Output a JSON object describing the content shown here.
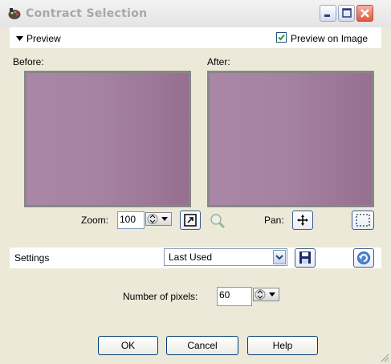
{
  "window": {
    "title": "Contract Selection",
    "icon": "paint-palette-icon"
  },
  "preview": {
    "toggle_label": "Preview",
    "preview_on_image_label": "Preview on Image",
    "preview_on_image_checked": true,
    "before_label": "Before:",
    "after_label": "After:",
    "swatch_color": "#a483a0",
    "zoom_label": "Zoom:",
    "zoom_value": "100",
    "pan_label": "Pan:"
  },
  "settings": {
    "label": "Settings",
    "preset_value": "Last Used"
  },
  "params": {
    "pixels_label": "Number of pixels:",
    "pixels_value": "60"
  },
  "buttons": {
    "ok": "OK",
    "cancel": "Cancel",
    "help": "Help"
  },
  "colors": {
    "accent": "#003c74",
    "panel": "#ece9d8",
    "close": "#e0573e"
  }
}
